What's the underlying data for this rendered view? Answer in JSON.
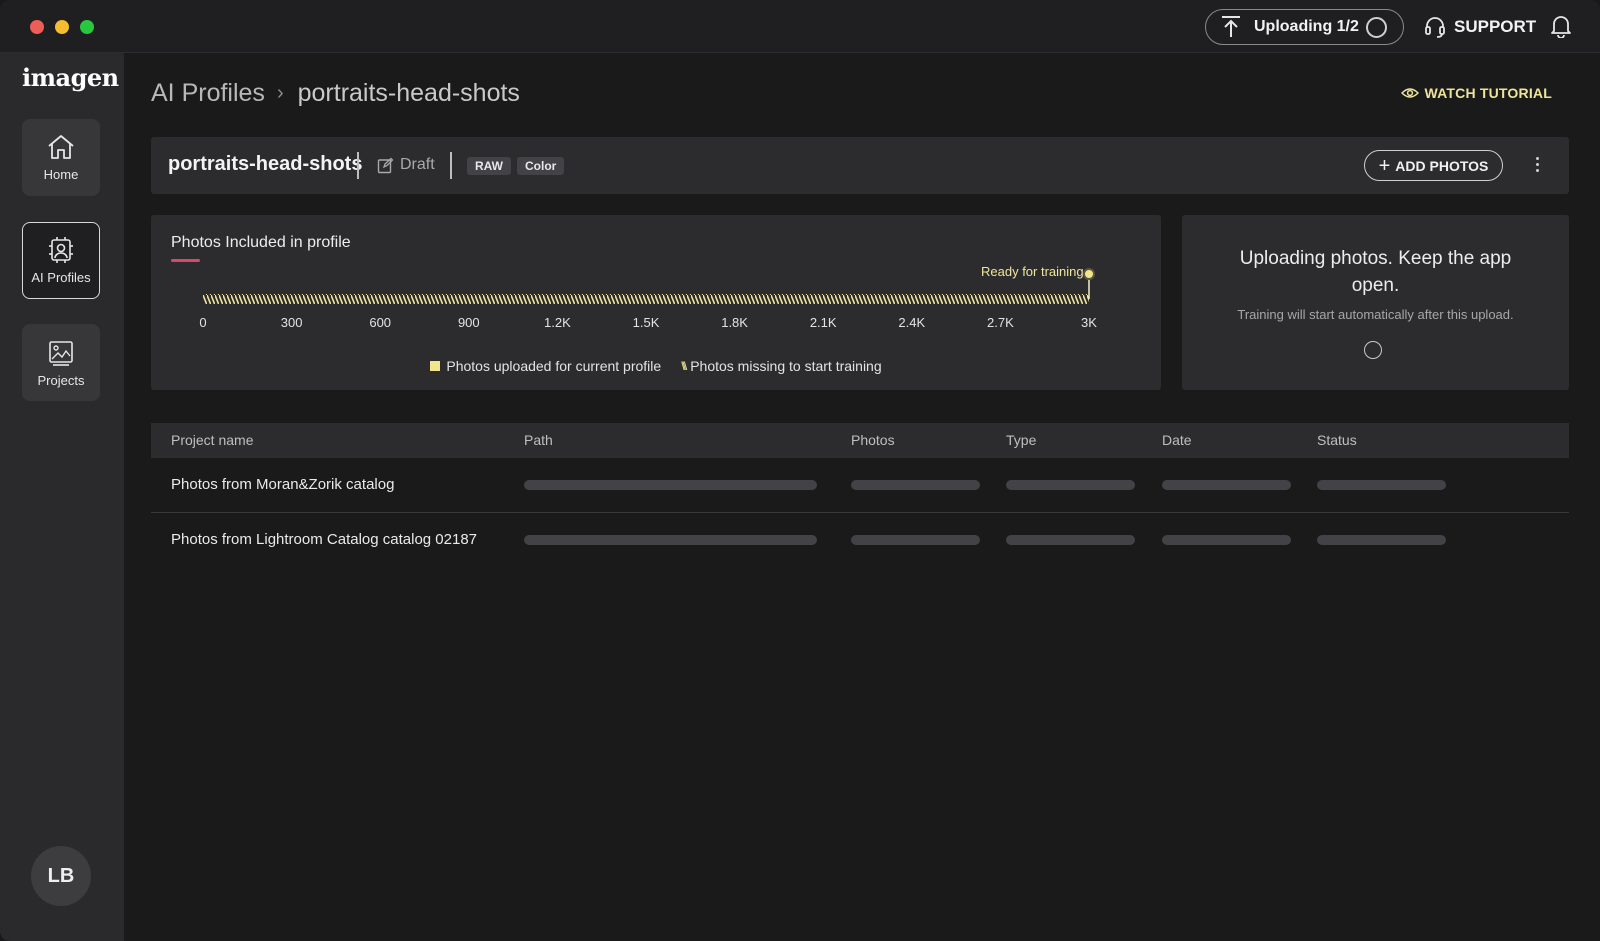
{
  "titlebar": {
    "upload_status": "Uploading 1/2",
    "support_label": "SUPPORT"
  },
  "sidebar": {
    "logo": "imagen",
    "items": [
      {
        "label": "Home",
        "icon": "home-icon"
      },
      {
        "label": "AI Profiles",
        "icon": "ai-profile-icon",
        "active": true
      },
      {
        "label": "Projects",
        "icon": "projects-icon"
      }
    ],
    "avatar_initials": "LB"
  },
  "breadcrumb": {
    "root": "AI Profiles",
    "current": "portraits-head-shots"
  },
  "watch_tutorial": "WATCH TUTORIAL",
  "profile": {
    "name": "portraits-head-shots",
    "status": "Draft",
    "tags": [
      "RAW",
      "Color"
    ],
    "add_photos_label": "ADD PHOTOS"
  },
  "photos_chart": {
    "title": "Photos Included in profile",
    "ready_label": "Ready for training",
    "legend": {
      "uploaded": "Photos uploaded for current profile",
      "missing": "Photos missing to start training"
    }
  },
  "chart_data": {
    "type": "bar",
    "orientation": "horizontal",
    "categories": [
      "Photos"
    ],
    "series": [
      {
        "name": "Photos uploaded for current profile",
        "values": [
          0
        ]
      },
      {
        "name": "Photos missing to start training",
        "values": [
          3000
        ]
      }
    ],
    "xlim": [
      0,
      3000
    ],
    "x_ticks": [
      "0",
      "300",
      "600",
      "900",
      "1.2K",
      "1.5K",
      "1.8K",
      "2.1K",
      "2.4K",
      "2.7K",
      "3K"
    ],
    "annotations": [
      {
        "label": "Ready for training",
        "x": 3000
      }
    ],
    "colors": {
      "uploaded": "#f2e68c",
      "missing": "#efe59a",
      "marker": "#f2e68c"
    }
  },
  "upload_panel": {
    "title": "Uploading photos. Keep the app open.",
    "subtitle": "Training will start automatically after this upload."
  },
  "table": {
    "columns": [
      "Project name",
      "Path",
      "Photos",
      "Type",
      "Date",
      "Status"
    ],
    "rows": [
      {
        "name": "Photos from Moran&Zorik catalog"
      },
      {
        "name": "Photos from Lightroom Catalog catalog 02187"
      }
    ]
  },
  "colors": {
    "accent_yellow": "#efe59a",
    "accent_pink": "#d9486b",
    "background": "#1a1a1b",
    "card": "#2c2c2f"
  }
}
